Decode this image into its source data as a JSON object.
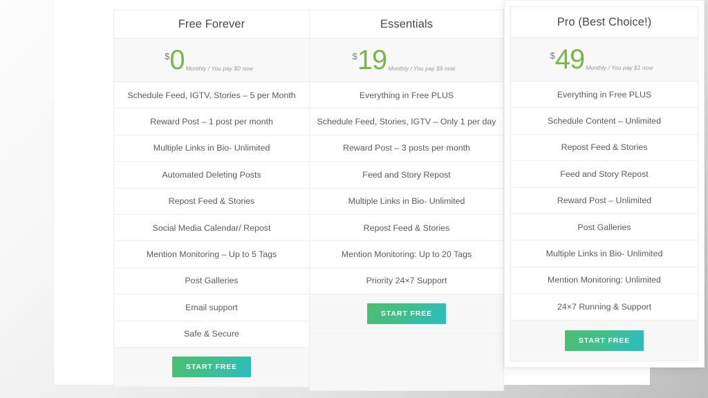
{
  "theme": {
    "accent_green": "#7ab648",
    "cta_gradient_start": "#4fbd6e",
    "cta_gradient_end": "#2bbcc4",
    "text_color": "#5b5b5b",
    "row_border": "#efefef",
    "price_row_bg": "#f8f8f8"
  },
  "plans": [
    {
      "id": "free",
      "name": "Free Forever",
      "featured": false,
      "currency": "$",
      "amount": "0",
      "note": "Monthly / You pay $0 now",
      "features": [
        "Schedule Feed, IGTV, Stories – 5 per Month",
        "Reward Post – 1 post per month",
        "Multiple Links in Bio- Unlimited",
        "Automated Deleting Posts",
        "Repost Feed & Stories",
        "Social Media Calendar/ Repost",
        "Mention Monitoring – Up to 5 Tags",
        "Post Galleries",
        "Email support",
        "Safe & Secure"
      ],
      "cta_label": "START FREE"
    },
    {
      "id": "essentials",
      "name": "Essentials",
      "featured": false,
      "currency": "$",
      "amount": "19",
      "note": "Monthly / You pay $9 now",
      "features": [
        "Everything in Free PLUS",
        "Schedule Feed, Stories, IGTV – Only 1 per day",
        "Reward Post – 3 posts per month",
        "Feed and Story Repost",
        "Multiple Links in Bio- Unlimited",
        "Repost Feed & Stories",
        "Mention Monitoring: Up to 20 Tags",
        "Priority 24×7 Support"
      ],
      "cta_label": "START FREE"
    },
    {
      "id": "pro",
      "name": "Pro (Best Choice!)",
      "featured": true,
      "currency": "$",
      "amount": "49",
      "note": "Monthly / You pay $1 now",
      "features": [
        "Everything in Free PLUS",
        "Schedule Content – Unlimited",
        "Repost Feed & Stories",
        "Feed and Story Repost",
        "Reward Post – Unlimited",
        "Post Galleries",
        "Multiple Links in Bio- Unlimited",
        "Mention Monitoring: Unlimited",
        "24×7 Running & Support"
      ],
      "cta_label": "START FREE"
    }
  ]
}
